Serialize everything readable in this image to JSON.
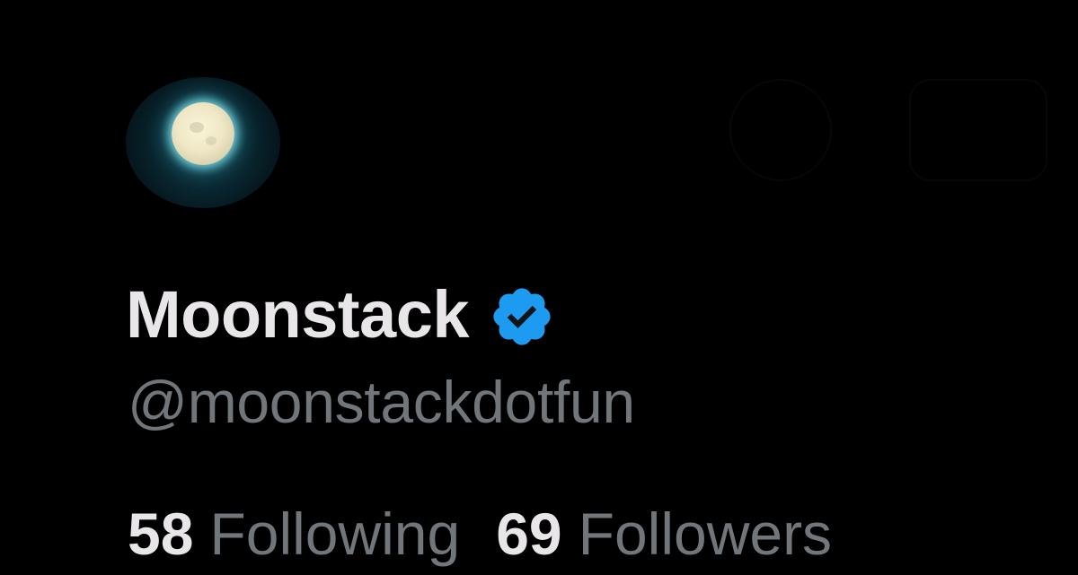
{
  "profile": {
    "display_name": "Moonstack",
    "handle": "@moonstackdotfun",
    "verified": true,
    "avatar_icon": "moon-avatar"
  },
  "stats": {
    "following_count": "58",
    "following_label": "Following",
    "followers_count": "69",
    "followers_label": "Followers"
  },
  "colors": {
    "background": "#000000",
    "name_text": "#e9e6e9",
    "secondary_text": "#71767b",
    "verified_badge": "#1d9bf0"
  }
}
